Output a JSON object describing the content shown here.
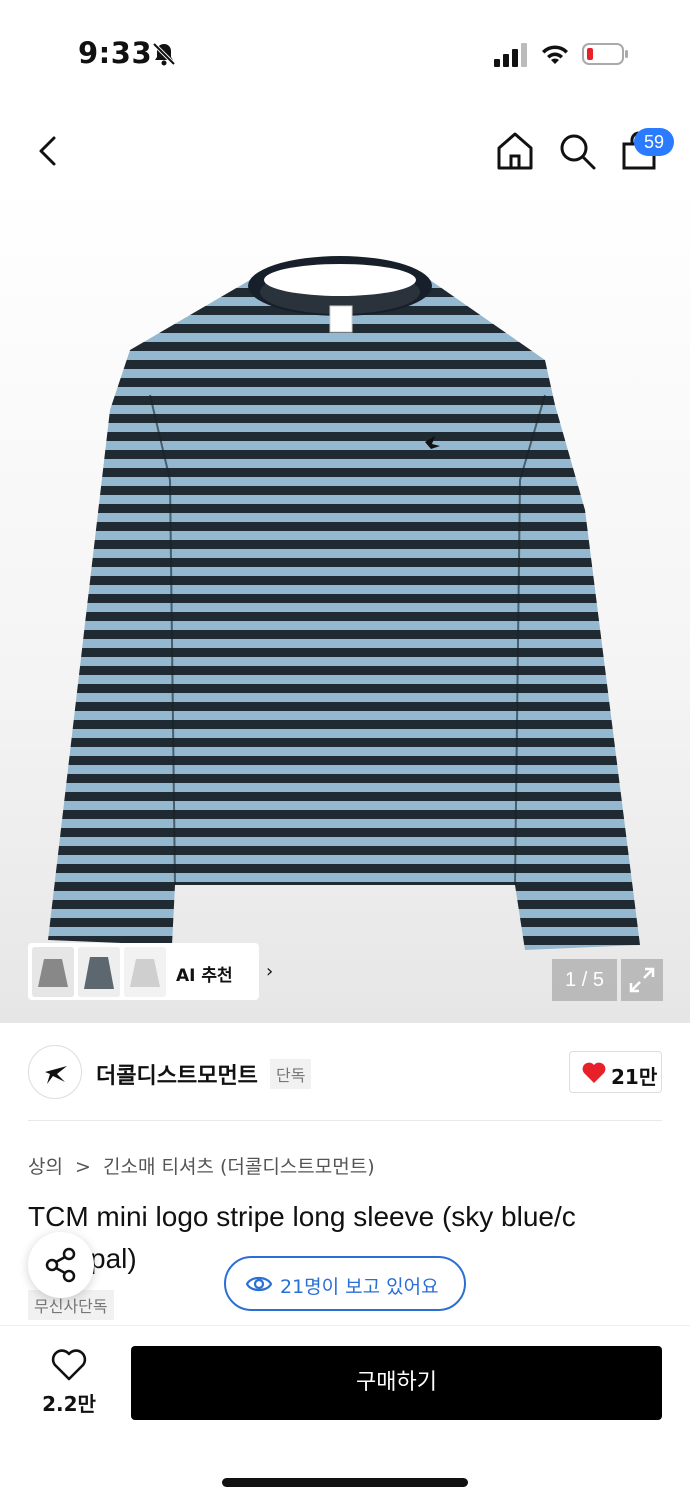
{
  "status_bar": {
    "time": "9:33"
  },
  "nav": {
    "cart_count": "59"
  },
  "gallery": {
    "ai_label": "AI 추천",
    "pager": "1 / 5",
    "stripe_colors": [
      "#1f2a33",
      "#93b8cf"
    ]
  },
  "brand": {
    "name": "더콜디스트모먼트",
    "exclusive": "단독",
    "likes": "21만"
  },
  "product": {
    "breadcrumb": [
      "상의",
      ">",
      "긴소매 티셔츠 (더콜디스트모먼트)"
    ],
    "title_line1": "TCM mini logo stripe long sleeve (sky blue/c",
    "title_line2": "pal)",
    "tag": "무신사단독",
    "viewers": "21명이 보고 있어요"
  },
  "bottom_bar": {
    "favorites": "2.2만",
    "buy_label": "구매하기"
  },
  "colors": {
    "accent_blue": "#2a7bff",
    "viewer_blue": "#2a6fd6",
    "heart_red": "#e8202a"
  }
}
